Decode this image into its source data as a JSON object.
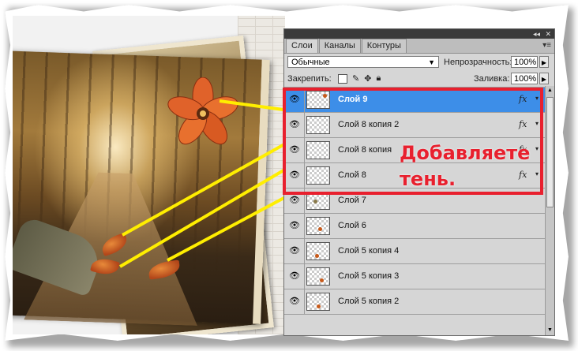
{
  "panel": {
    "tabs": [
      {
        "label": "Слои",
        "active": true
      },
      {
        "label": "Каналы",
        "active": false
      },
      {
        "label": "Контуры",
        "active": false
      }
    ],
    "blend_mode": "Обычные",
    "opacity_label": "Непрозрачность:",
    "opacity_value": "100%",
    "lock_label": "Закрепить:",
    "fill_label": "Заливка:",
    "fill_value": "100%",
    "layers": [
      {
        "name": "Слой 9",
        "selected": true,
        "fx": "fx"
      },
      {
        "name": "Слой 8 копия 2",
        "selected": false,
        "fx": "fx"
      },
      {
        "name": "Слой 8 копия",
        "selected": false,
        "fx": "fx"
      },
      {
        "name": "Слой 8",
        "selected": false,
        "fx": "fx"
      },
      {
        "name": "Слой 7",
        "selected": false,
        "fx": ""
      },
      {
        "name": "Слой 6",
        "selected": false,
        "fx": ""
      },
      {
        "name": "Слой 5 копия 4",
        "selected": false,
        "fx": ""
      },
      {
        "name": "Слой 5 копия 3",
        "selected": false,
        "fx": ""
      },
      {
        "name": "Слой 5 копия 2",
        "selected": false,
        "fx": ""
      }
    ]
  },
  "annotation": {
    "line1": "Добавляете",
    "line2": "тень."
  },
  "colors": {
    "highlight": "#e8202e",
    "pointer": "#ffee00",
    "selected_layer": "#3d8ee8"
  }
}
